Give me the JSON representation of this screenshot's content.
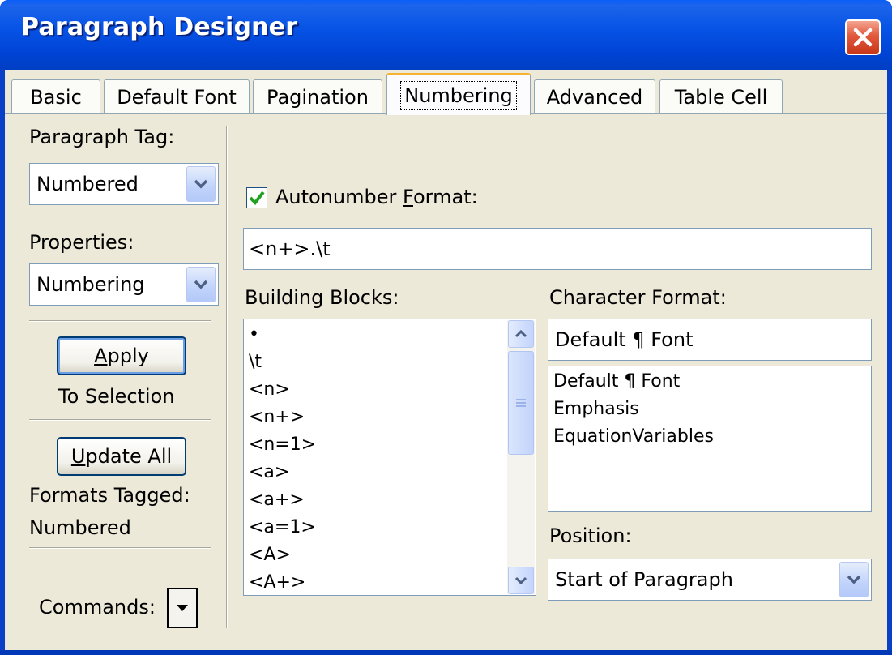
{
  "window": {
    "title": "Paragraph Designer"
  },
  "tabs": [
    {
      "label": "Basic"
    },
    {
      "label": "Default Font"
    },
    {
      "label": "Pagination"
    },
    {
      "label": "Numbering"
    },
    {
      "label": "Advanced"
    },
    {
      "label": "Table Cell"
    }
  ],
  "active_tab": "Numbering",
  "left_panel": {
    "paragraph_tag_label": "Paragraph Tag:",
    "paragraph_tag_value": "Numbered",
    "properties_label": "Properties:",
    "properties_value": "Numbering",
    "apply_prefix": "",
    "apply_hotkey": "A",
    "apply_rest": "pply",
    "to_selection": "To Selection",
    "update_hotkey": "U",
    "update_rest": "pdate All",
    "formats_tagged_label": "Formats Tagged:",
    "formats_tagged_value": "Numbered",
    "commands_label": "Commands:"
  },
  "numbering": {
    "autonumber_checked": true,
    "autonumber_label_pre": "Autonumber ",
    "autonumber_label_hotkey": "F",
    "autonumber_label_post": "ormat:",
    "autonumber_value": "<n+>.\\t",
    "building_blocks_label": "Building Blocks:",
    "building_blocks": [
      "•",
      "\\t",
      "<n>",
      "<n+>",
      "<n=1>",
      "<a>",
      "<a+>",
      "<a=1>",
      "<A>",
      "<A+>"
    ],
    "character_format_label": "Character Format:",
    "character_format_value": "Default ¶ Font",
    "character_formats": [
      "Default ¶ Font",
      "Emphasis",
      "EquationVariables"
    ],
    "position_label": "Position:",
    "position_value": "Start of Paragraph"
  },
  "colors": {
    "title_bar": "#0054e3",
    "dialog_face": "#ece9d8",
    "close_button": "#e2593d",
    "active_tab_accent": "#f7b231"
  }
}
